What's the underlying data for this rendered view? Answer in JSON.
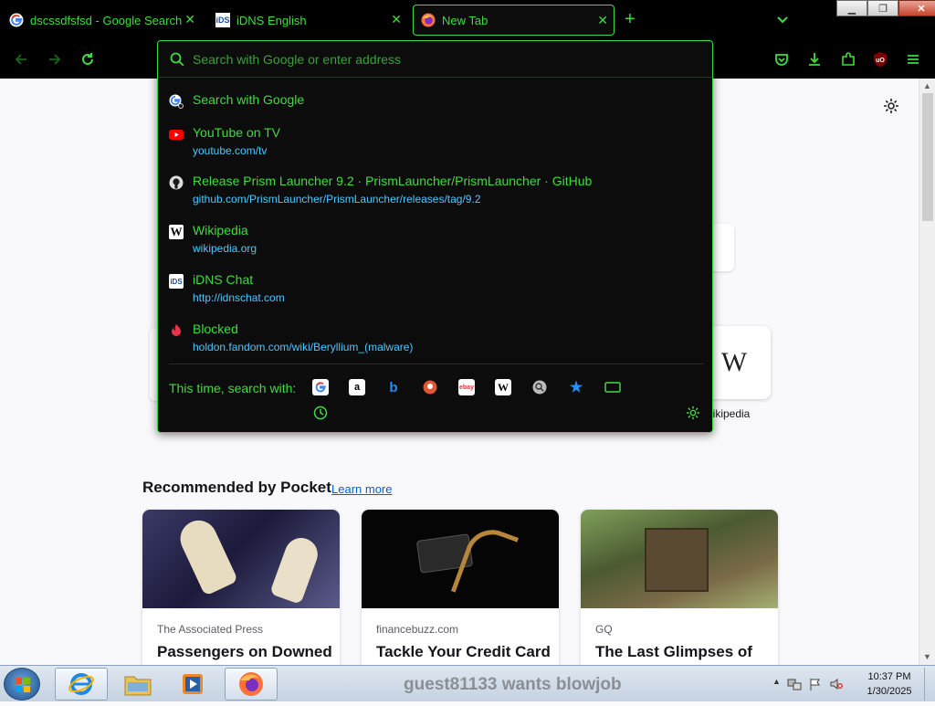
{
  "tabs": [
    {
      "title": "dscssdfsfsd - Google Search",
      "favicon": "google-g"
    },
    {
      "title": "iDNS English",
      "favicon": "idns"
    },
    {
      "title": "New Tab",
      "favicon": "firefox"
    }
  ],
  "address_bar": {
    "placeholder": "Search with Google or enter address"
  },
  "suggestions": [
    {
      "title": "Search with Google",
      "url": "",
      "icon": "google-search"
    },
    {
      "title": "YouTube on TV",
      "url": "youtube.com/tv",
      "icon": "youtube"
    },
    {
      "title": "Release Prism Launcher 9.2 · PrismLauncher/PrismLauncher · GitHub",
      "url": "github.com/PrismLauncher/PrismLauncher/releases/tag/9.2",
      "icon": "github"
    },
    {
      "title": "Wikipedia",
      "url": "wikipedia.org",
      "icon": "wikipedia"
    },
    {
      "title": "iDNS Chat",
      "url": "http://idnschat.com",
      "icon": "idns"
    },
    {
      "title": "Blocked",
      "url": "holdon.fandom.com/wiki/Beryllium_(malware)",
      "icon": "blocked"
    }
  ],
  "search_with": {
    "label": "This time, search with:",
    "engines": [
      "google",
      "amazon",
      "bing",
      "duckduckgo",
      "ebay",
      "wikipedia",
      "search",
      "bookmarks",
      "tabs",
      "history"
    ]
  },
  "page": {
    "top_site_label": "wikipedia",
    "pocket_title": "Recommended by Pocket",
    "pocket_learn_more": "Learn more",
    "cards": [
      {
        "source": "The Associated Press",
        "headline": "Passengers on Downed"
      },
      {
        "source": "financebuzz.com",
        "headline": "Tackle Your Credit Card"
      },
      {
        "source": "GQ",
        "headline": "The Last Glimpses of"
      }
    ]
  },
  "taskbar": {
    "notification": "guest81133 wants blowjob",
    "time": "10:37 PM",
    "date": "1/30/2025"
  },
  "colors": {
    "accent": "#3fdc3f",
    "url_color": "#4fc7ff",
    "background": "#000000"
  }
}
